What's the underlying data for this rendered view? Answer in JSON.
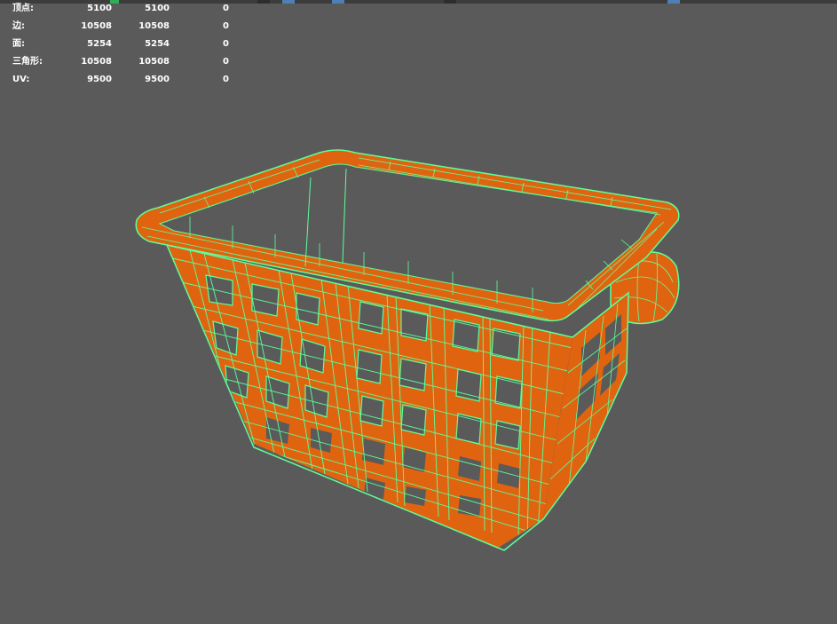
{
  "hud": {
    "rows": [
      {
        "label": "顶点:",
        "v1": "5100",
        "v2": "5100",
        "v3": "0"
      },
      {
        "label": "边:",
        "v1": "10508",
        "v2": "10508",
        "v3": "0"
      },
      {
        "label": "面:",
        "v1": "5254",
        "v2": "5254",
        "v3": "0"
      },
      {
        "label": "三角形:",
        "v1": "10508",
        "v2": "10508",
        "v3": "0"
      },
      {
        "label": "UV:",
        "v1": "9500",
        "v2": "9500",
        "v3": "0"
      }
    ]
  },
  "colors": {
    "background": "#5a5a5a",
    "mesh_fill": "#e0640f",
    "wireframe": "#5cff9a",
    "hud_text": "#ffffff"
  },
  "viewport": {
    "object_icon": "laundry-basket-mesh-icon"
  }
}
